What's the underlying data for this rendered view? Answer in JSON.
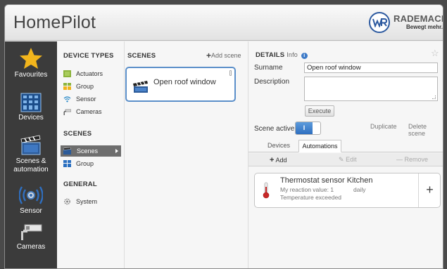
{
  "header": {
    "app_title": "HomePilot",
    "brand_name": "RADEMACHER",
    "brand_slogan": "Bewegt mehr."
  },
  "left_nav": {
    "items": [
      {
        "label": "Favourites",
        "icon": "star-icon"
      },
      {
        "label": "Devices",
        "icon": "devices-grid-icon"
      },
      {
        "label": "Scenes &\nautomation",
        "icon": "clapperboard-icon"
      },
      {
        "label": "Sensor",
        "icon": "sensor-waves-icon"
      },
      {
        "label": "Cameras",
        "icon": "camera-icon"
      }
    ]
  },
  "categories": {
    "device_types_heading": "DEVICE TYPES",
    "device_types": [
      {
        "label": "Actuators",
        "icon": "actuator-icon"
      },
      {
        "label": "Group",
        "icon": "group-icon"
      },
      {
        "label": "Sensor",
        "icon": "wifi-sensor-icon"
      },
      {
        "label": "Cameras",
        "icon": "camera-small-icon"
      }
    ],
    "scenes_heading": "SCENES",
    "scenes": [
      {
        "label": "Scenes",
        "icon": "clapperboard-small-icon",
        "active": true
      },
      {
        "label": "Group",
        "icon": "group-icon"
      }
    ],
    "general_heading": "GENERAL",
    "general": [
      {
        "label": "System",
        "icon": "gear-icon"
      }
    ]
  },
  "scenes_panel": {
    "heading": "SCENES",
    "add_label": "Add scene",
    "scene_name": "Open roof window"
  },
  "details": {
    "heading": "DETAILS",
    "info_label": "Info",
    "surname_label": "Surname",
    "surname_value": "Open roof window",
    "description_label": "Description",
    "description_value": "",
    "execute_label": "Execute",
    "scene_active_label": "Scene active",
    "toggle_on_label": "I",
    "duplicate_label": "Duplicate",
    "delete_label": "Delete scene",
    "tabs": [
      "Devices",
      "Automations"
    ],
    "active_tab": "Automations",
    "add_label": "Add",
    "edit_label": "Edit",
    "remove_label": "Remove",
    "automation": {
      "title": "Thermostat sensor Kitchen",
      "reaction": "My reaction value: 1",
      "schedule": "daily",
      "condition": "Temperature exceeded"
    }
  },
  "colors": {
    "accent": "#3d7ac8",
    "nav_bg": "#3b3b3b",
    "star": "#f2b51c"
  }
}
